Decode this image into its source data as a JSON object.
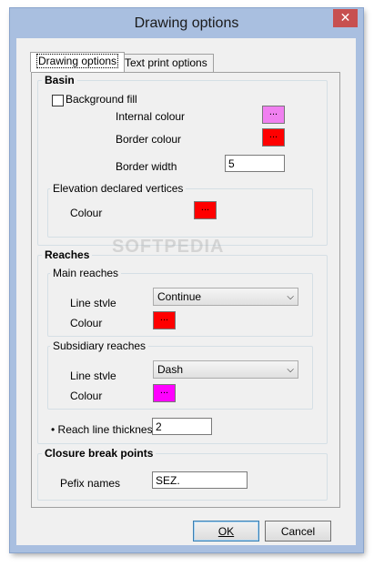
{
  "window": {
    "title": "Drawing options",
    "close_glyph": "✕"
  },
  "tabs": [
    {
      "label": "Drawing options",
      "active": true
    },
    {
      "label": "Text print options",
      "active": false
    }
  ],
  "basin": {
    "title": "Basin",
    "background_fill_label": "Background fill",
    "background_fill_checked": false,
    "internal_colour_label": "Internal colour",
    "internal_colour": "#f080f0",
    "border_colour_label": "Border colour",
    "border_colour": "#ff0000",
    "border_width_label": "Border width",
    "border_width_value": "5",
    "elevation": {
      "title": "Elevation declared vertices",
      "colour_label": "Colour",
      "colour": "#ff0000"
    }
  },
  "reaches": {
    "title": "Reaches",
    "main": {
      "title": "Main reaches",
      "line_style_label": "Line stvle",
      "line_style_value": "Continue",
      "colour_label": "Colour",
      "colour": "#ff0000"
    },
    "subsidiary": {
      "title": "Subsidiary reaches",
      "line_style_label": "Line stvle",
      "line_style_value": "Dash",
      "colour_label": "Colour",
      "colour": "#ff00ff"
    },
    "thickness_label": "Reach line thickness",
    "thickness_value": "2"
  },
  "closure": {
    "title": "Closure break points",
    "prefix_label": "Pefix names",
    "prefix_value": "SEZ."
  },
  "swatch_glyph": "...",
  "buttons": {
    "ok": "OK",
    "cancel": "Cancel"
  },
  "watermark": "SOFTPEDIA"
}
